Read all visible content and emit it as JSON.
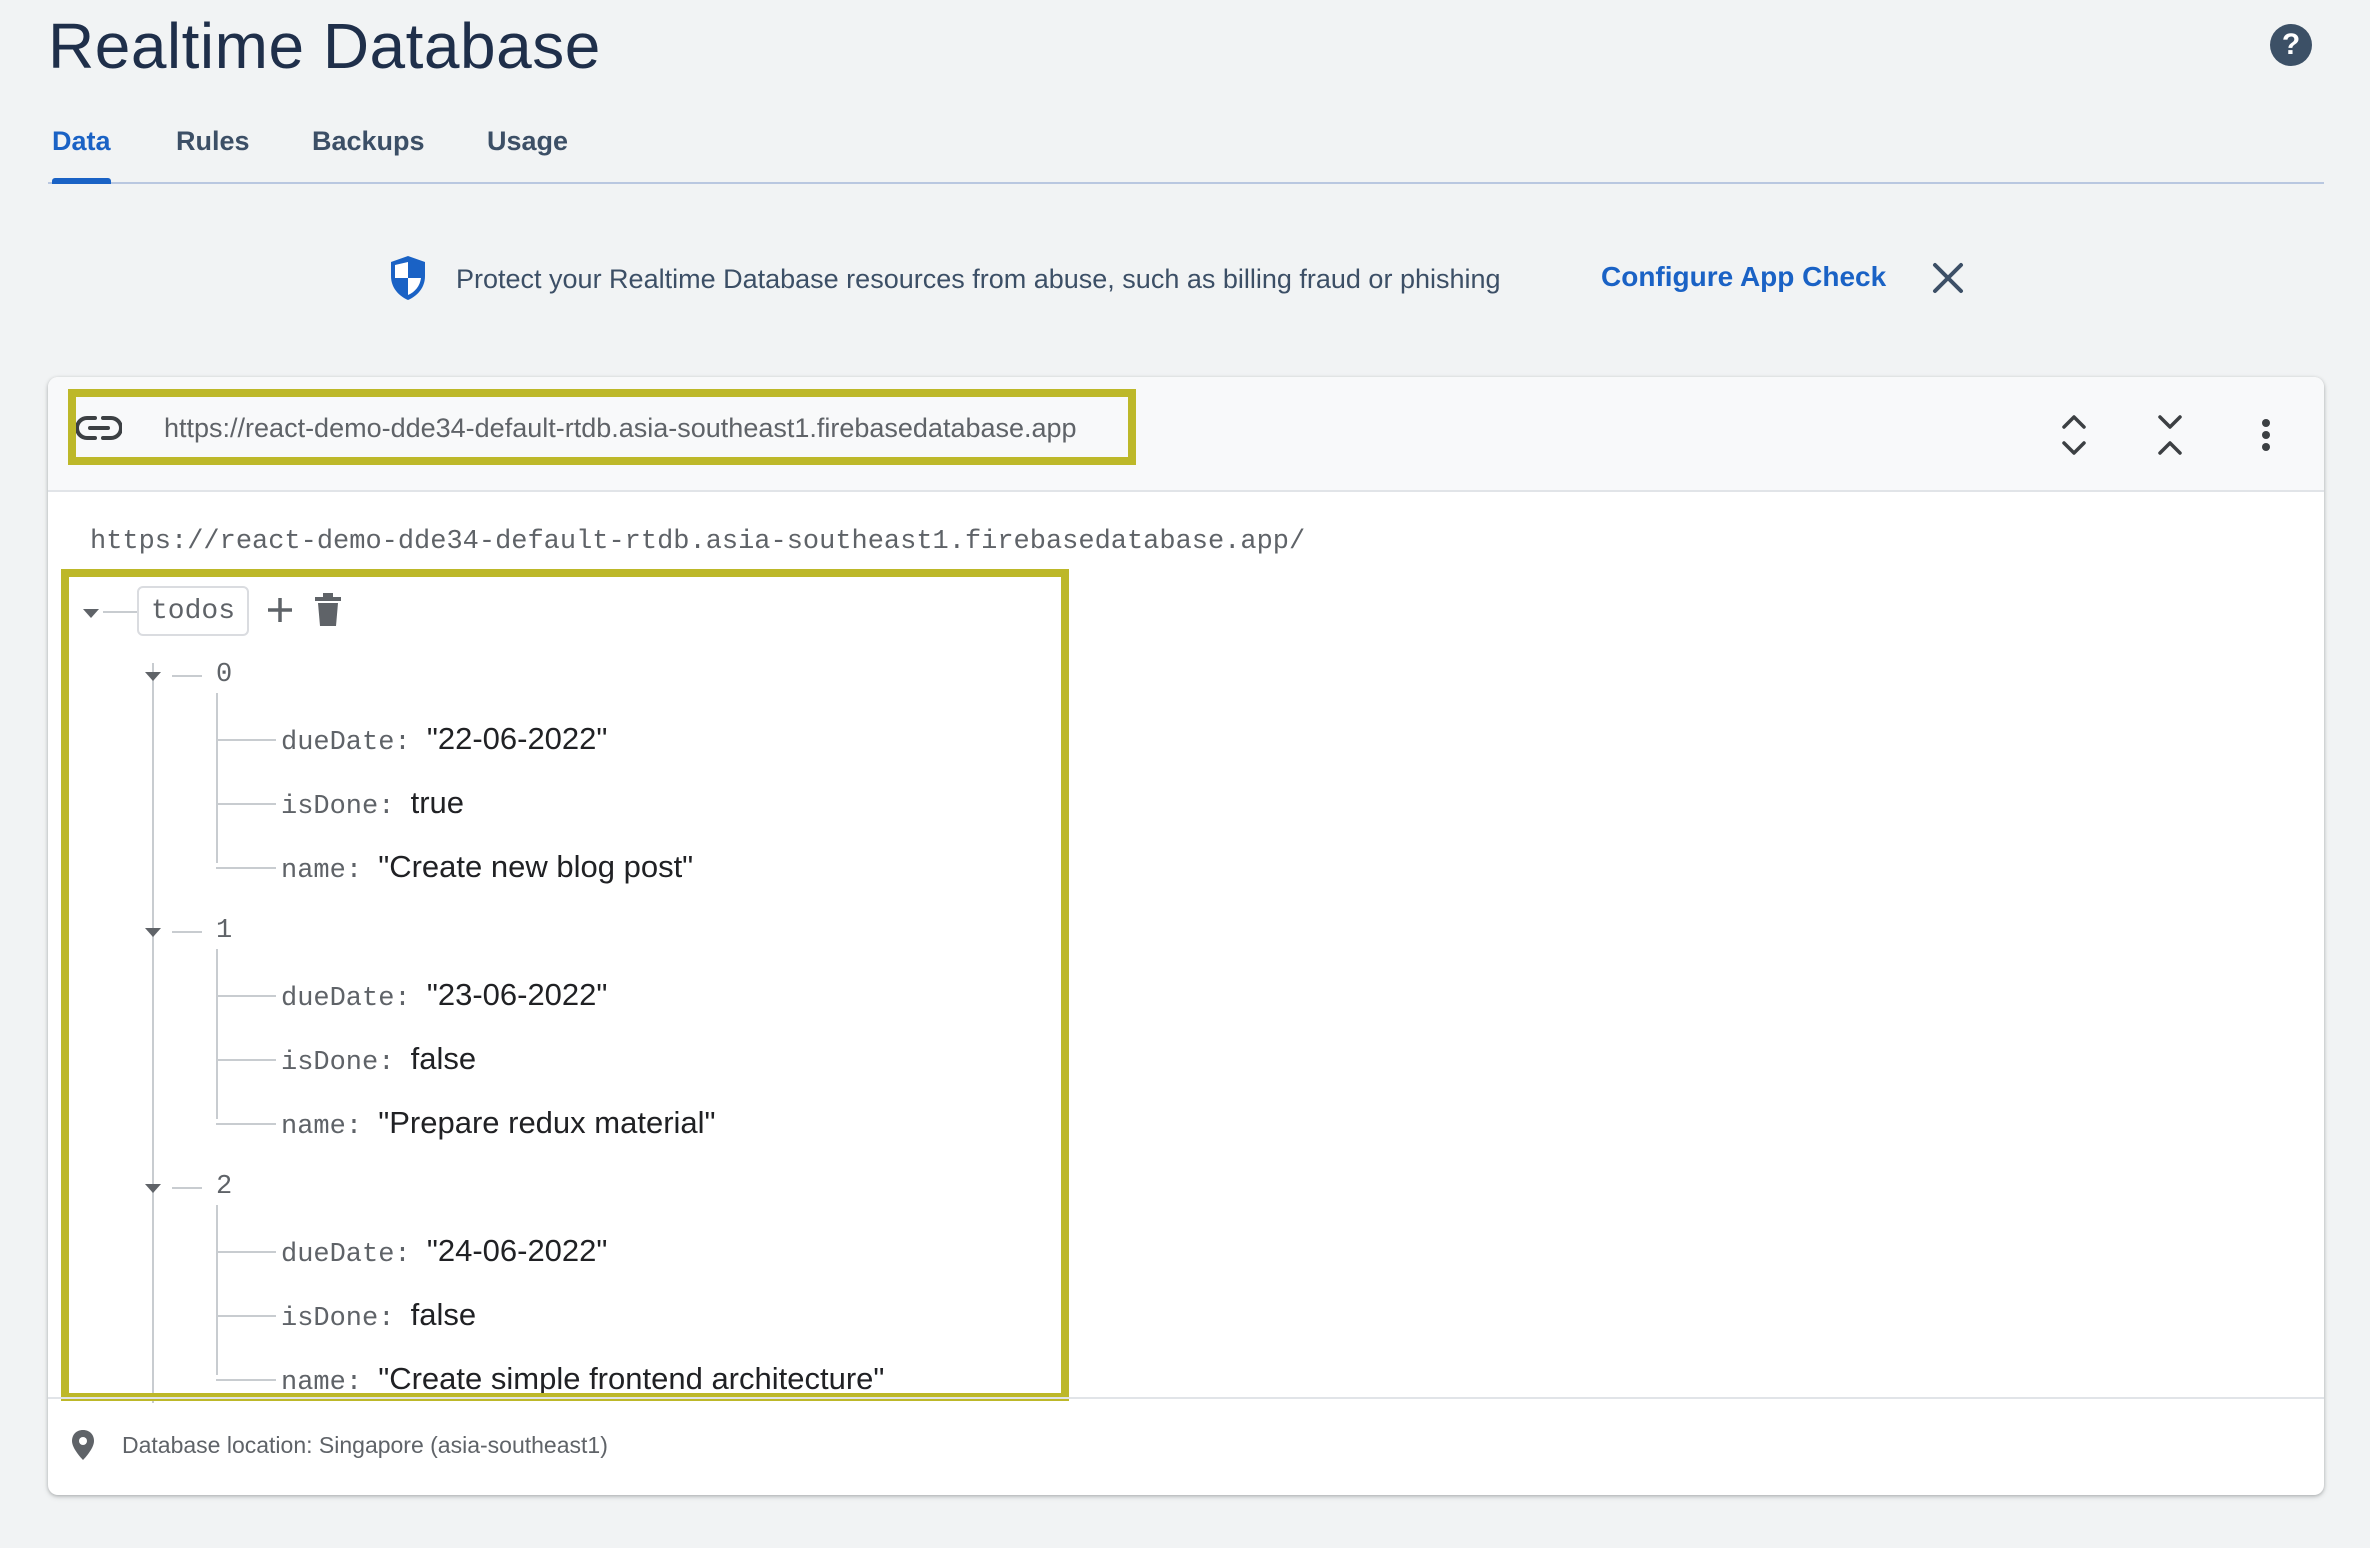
{
  "page": {
    "title": "Realtime Database",
    "help_icon": "help-icon"
  },
  "tabs": [
    {
      "label": "Data",
      "active": true
    },
    {
      "label": "Rules",
      "active": false
    },
    {
      "label": "Backups",
      "active": false
    },
    {
      "label": "Usage",
      "active": false
    }
  ],
  "banner": {
    "icon": "shield-icon",
    "text": "Protect your Realtime Database resources from abuse, such as billing fraud or phishing",
    "link_label": "Configure App Check",
    "close_icon": "close-icon"
  },
  "database": {
    "url": "https://react-demo-dde34-default-rtdb.asia-southeast1.firebasedatabase.app",
    "ref_url": "https://react-demo-dde34-default-rtdb.asia-southeast1.firebasedatabase.app/",
    "root_key": "todos",
    "items": [
      {
        "index": "0",
        "fields": [
          {
            "key": "dueDate",
            "value": "\"22-06-2022\""
          },
          {
            "key": "isDone",
            "value": "true"
          },
          {
            "key": "name",
            "value": "\"Create new blog post\""
          }
        ]
      },
      {
        "index": "1",
        "fields": [
          {
            "key": "dueDate",
            "value": "\"23-06-2022\""
          },
          {
            "key": "isDone",
            "value": "false"
          },
          {
            "key": "name",
            "value": "\"Prepare redux material\""
          }
        ]
      },
      {
        "index": "2",
        "fields": [
          {
            "key": "dueDate",
            "value": "\"24-06-2022\""
          },
          {
            "key": "isDone",
            "value": "false"
          },
          {
            "key": "name",
            "value": "\"Create simple frontend architecture\""
          }
        ]
      }
    ]
  },
  "footer": {
    "location": "Database location: Singapore (asia-southeast1)"
  },
  "colors": {
    "accent": "#1a62c5",
    "highlight": "#bdb829"
  }
}
